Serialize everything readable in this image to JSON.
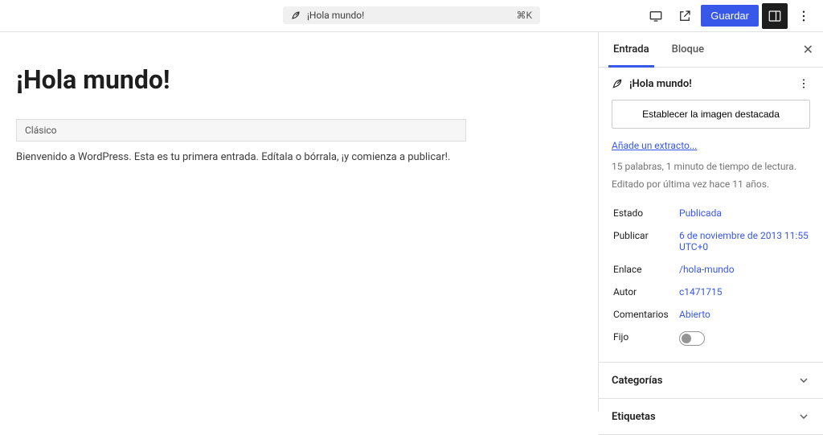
{
  "topbar": {
    "doc_title": "¡Hola mundo!",
    "shortcut": "⌘K",
    "save_label": "Guardar"
  },
  "editor": {
    "title": "¡Hola mundo!",
    "classic_label": "Clásico",
    "body": "Bienvenido a WordPress. Esta es tu primera entrada. Edítala o bórrala, ¡y comienza a publicar!."
  },
  "sidebar": {
    "tabs": {
      "entry": "Entrada",
      "block": "Bloque"
    },
    "summary_title": "¡Hola mundo!",
    "featured_image_btn": "Establecer la imagen destacada",
    "excerpt_link": "Añade un extracto...",
    "stats": "15 palabras, 1 minuto de tiempo de lectura.",
    "last_edit": "Editado por última vez hace 11 años.",
    "kv": {
      "status_label": "Estado",
      "status_value": "Publicada",
      "publish_label": "Publicar",
      "publish_value": "6 de noviembre de 2013 11:55 UTC+0",
      "link_label": "Enlace",
      "link_value": "/hola-mundo",
      "author_label": "Autor",
      "author_value": "c1471715",
      "comments_label": "Comentarios",
      "comments_value": "Abierto",
      "sticky_label": "Fijo"
    },
    "panels": {
      "categories": "Categorías",
      "tags": "Etiquetas"
    }
  }
}
